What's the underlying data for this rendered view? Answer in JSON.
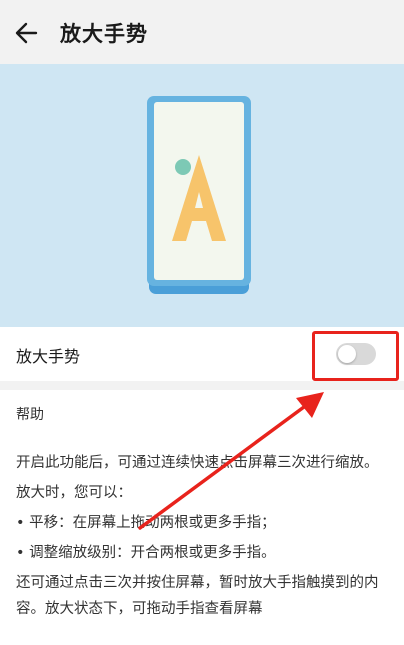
{
  "header": {
    "back_icon": "arrow-left-icon",
    "title": "放大手势"
  },
  "illustration": {
    "letter": "A",
    "colors": {
      "background": "#cfe6f3",
      "phone_frame": "#4a9fd8",
      "letter": "#f7c46b",
      "dot": "#7dc9b5"
    }
  },
  "setting": {
    "label": "放大手势",
    "toggle_on": false
  },
  "help": {
    "heading": "帮助",
    "paragraphs": [
      "开启此功能后，可通过连续快速点击屏幕三次进行缩放。",
      "放大时，您可以：",
      "• 平移：在屏幕上拖动两根或更多手指；",
      "• 调整缩放级别：开合两根或更多手指。",
      "还可通过点击三次并按住屏幕，暂时放大手指触摸到的内容。放大状态下，可拖动手指查看屏幕"
    ]
  },
  "annotation": {
    "highlight_color": "#e8231c"
  }
}
